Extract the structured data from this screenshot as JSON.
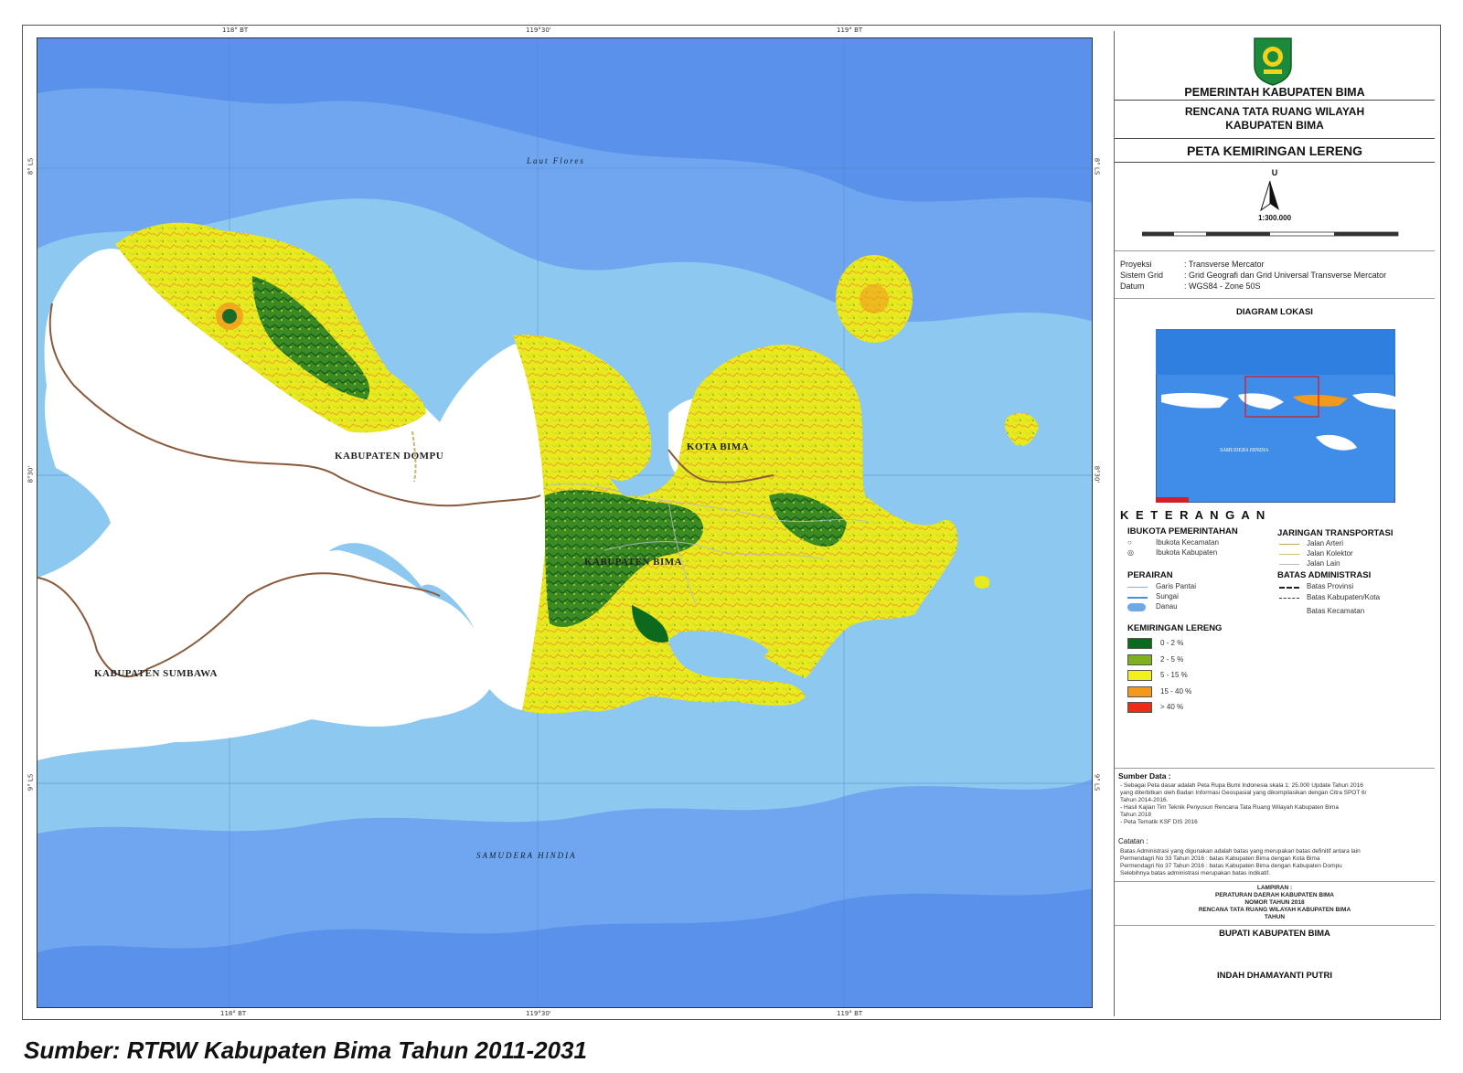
{
  "map": {
    "sea_labels": {
      "north": "Laut Flores",
      "south": "SAMUDERA HINDIA"
    },
    "regions": {
      "dompu": "KABUPATEN DOMPU",
      "kota_bima": "KOTA BIMA",
      "kab_bima": "KABUPATEN BIMA",
      "sumbawa": "KABUPATEN SUMBAWA"
    },
    "ticks": {
      "top": [
        "118°  BT",
        "119°30'",
        "119°  BT"
      ],
      "bottom": [
        "118° BT",
        "119°30'",
        "119°  BT"
      ],
      "left": [
        "8° LS",
        "8°30'",
        "9° LS"
      ],
      "right": [
        "8° LS",
        "8°30'",
        "9° LS"
      ]
    },
    "colors": {
      "sea_light": "#8cc8ef",
      "sea_deep": "#5a91ea",
      "land_white": "#ffffff",
      "boundary": "#8b5a3c"
    }
  },
  "panel": {
    "logo": "coat-of-arms-kabupaten-bima",
    "gov_title": "PEMERINTAH KABUPATEN BIMA",
    "plan_title_1": "RENCANA TATA RUANG WILAYAH",
    "plan_title_2": "KABUPATEN BIMA",
    "map_title": "PETA KEMIRINGAN LERENG",
    "north_letter": "U",
    "scale": "1:300.000",
    "projection": [
      {
        "label": "Proyeksi",
        "value": ": Transverse Mercator"
      },
      {
        "label": "Sistem Grid",
        "value": ": Grid Geografi dan Grid Universal Transverse Mercator"
      },
      {
        "label": "Datum",
        "value": ": WGS84 - Zone 50S"
      }
    ],
    "location_title": "DIAGRAM LOKASI",
    "location_sea": "SAMUDERA HINDIA",
    "keterangan": "K E T E R A N G A N",
    "ibukota": {
      "title": "IBUKOTA PEMERINTAHAN",
      "items": [
        "Ibukota Kecamatan",
        "Ibukota Kabupaten"
      ]
    },
    "jaringan": {
      "title": "JARINGAN TRANSPORTASI",
      "items": [
        "Jalan Arteri",
        "Jalan Kolektor",
        "Jalan Lain"
      ]
    },
    "perairan": {
      "title": "PERAIRAN",
      "items": [
        "Garis Pantai",
        "Sungai",
        "Danau"
      ]
    },
    "batas": {
      "title": "BATAS ADMINISTRASI",
      "items": [
        "Batas Provinsi",
        "Batas Kabupaten/Kota",
        "Batas Kecamatan"
      ]
    },
    "slope": {
      "title": "KEMIRINGAN LERENG",
      "classes": [
        {
          "label": "0 - 2 %",
          "color": "#0b6a1e"
        },
        {
          "label": "2 - 5 %",
          "color": "#7fb21a"
        },
        {
          "label": "5 - 15 %",
          "color": "#f1f11c"
        },
        {
          "label": "15 - 40 %",
          "color": "#f39a1c"
        },
        {
          "label": "> 40 %",
          "color": "#ee2a1a"
        }
      ]
    },
    "sumber_title": "Sumber Data :",
    "sumber_lines": [
      "- Sebagai Peta dasar adalah Peta Rupa Bumi Indonesia skala 1: 25.000 Update Tahun 2016",
      "yang diterbitkan oleh Badan Informasi Geospasial yang dikompilasikan dengan Citra SPOT 6/",
      "Tahun 2014-2016.",
      "- Hasil Kajian Tim Teknik Penyusun Rencana Tata Ruang Wilayah Kabupaten Bima",
      "Tahun 2018",
      "- Peta Tematik KSF DIS 2016"
    ],
    "catatan_title": "Catatan :",
    "catatan_lines": [
      "Batas Administrasi yang digunakan adalah batas yang merupakan batas definitif antara lain",
      "Permendagri No 33 Tahun 2016 : batas Kabupaten Bima dengan Kota Bima",
      "Permendagri No 37 Tahun 2016 : batas Kabupaten Bima dengan Kabupaten Dompu",
      "Selebihnya batas administrasi merupakan batas indikatif."
    ],
    "lampiran": [
      "LAMPIRAN :",
      "PERATURAN DAERAH KABUPATEN BIMA",
      "NOMOR        TAHUN 2018",
      "RENCANA TATA RUANG WILAYAH KABUPATEN BIMA",
      "TAHUN"
    ],
    "bupati_title": "BUPATI KABUPATEN BIMA",
    "bupati_name": "INDAH DHAMAYANTI PUTRI"
  },
  "caption": "Sumber: RTRW Kabupaten Bima Tahun 2011-2031"
}
